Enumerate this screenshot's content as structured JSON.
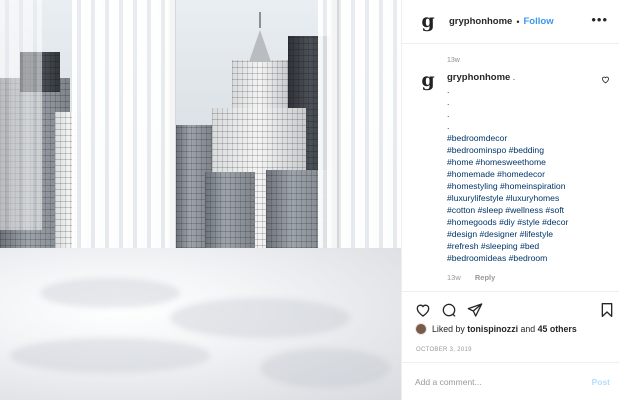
{
  "post": {
    "author": {
      "avatar_letter": "g",
      "handle": "gryphonhome",
      "separator": "•",
      "follow_label": "Follow"
    },
    "more_label": "•••",
    "timestamp_top": "13w",
    "caption": {
      "handle": "gryphonhome",
      "lines": [
        ".",
        ".",
        ".",
        "."
      ],
      "hashtag_lines": [
        "#bedroomdecor",
        "#bedroominspo #bedding",
        "#home #homesweethome",
        "#homemade #homedecor",
        "#homestyling #homeinspiration",
        "#luxurylifestyle #luxuryhomes",
        "#cotton #sleep #wellness #soft",
        "#homegoods #diy #style #decor",
        "#design #designer #lifestyle",
        "#refresh #sleeping #bed",
        "#bedroomideas #bedroom"
      ],
      "time": "13w",
      "reply_label": "Reply"
    },
    "actions": {
      "like_icon": "heart-icon",
      "comment_icon": "comment-icon",
      "share_icon": "share-icon",
      "save_icon": "bookmark-icon"
    },
    "likes": {
      "prefix": "Liked by ",
      "user": "tonispinozzi",
      "middle": " and ",
      "others": "45 others"
    },
    "date": "OCTOBER 3, 2019",
    "comment": {
      "placeholder": "Add a comment...",
      "post_label": "Post"
    }
  },
  "colors": {
    "accent": "#3897f0",
    "post_disabled": "#b2dffc",
    "hashtag": "#003569",
    "muted": "#999999"
  }
}
